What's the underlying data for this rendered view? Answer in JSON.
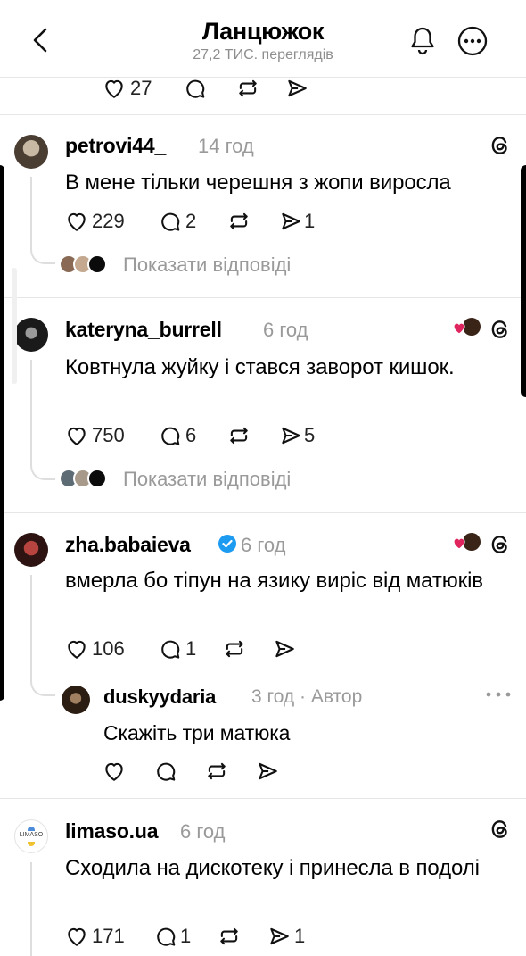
{
  "header": {
    "title": "Ланцюжок",
    "subtitle": "27,2 ТИС. переглядів"
  },
  "top_actions": {
    "likes": "27"
  },
  "posts": [
    {
      "username": "petrovi44_",
      "time": "14 год",
      "text": "В мене тільки черешня з жопи виросла",
      "likes": "229",
      "replies": "2",
      "shares": "1",
      "show_replies": "Показати відповіді"
    },
    {
      "username": "kateryna_burrell",
      "time": "6 год",
      "text": "Ковтнула жуйку і стався заворот кишок.",
      "likes": "750",
      "replies": "6",
      "shares": "5",
      "show_replies": "Показати відповіді"
    },
    {
      "username": "zha.babaieva",
      "time": "6 год",
      "text": "вмерла бо тіпун на язику виріс від матюків",
      "likes": "106",
      "replies": "1",
      "reply": {
        "username": "duskyydaria",
        "time": "3 год · Автор",
        "text": "Скажіть три матюка"
      }
    },
    {
      "username": "limaso.ua",
      "time": "6 год",
      "text": "Сходила на дискотеку і принесла в подолі",
      "likes": "171",
      "replies": "1",
      "shares": "1",
      "avatar_text": "LIMASO"
    }
  ],
  "icons": [
    "back-icon",
    "bell-icon",
    "more-icon",
    "threads-icon",
    "heart-icon",
    "comment-icon",
    "repost-icon",
    "share-icon",
    "verified-icon"
  ],
  "colors": {
    "accent_verified": "#1d9bf0",
    "muted": "#9a9a9a",
    "like_red": "#e0245e"
  }
}
